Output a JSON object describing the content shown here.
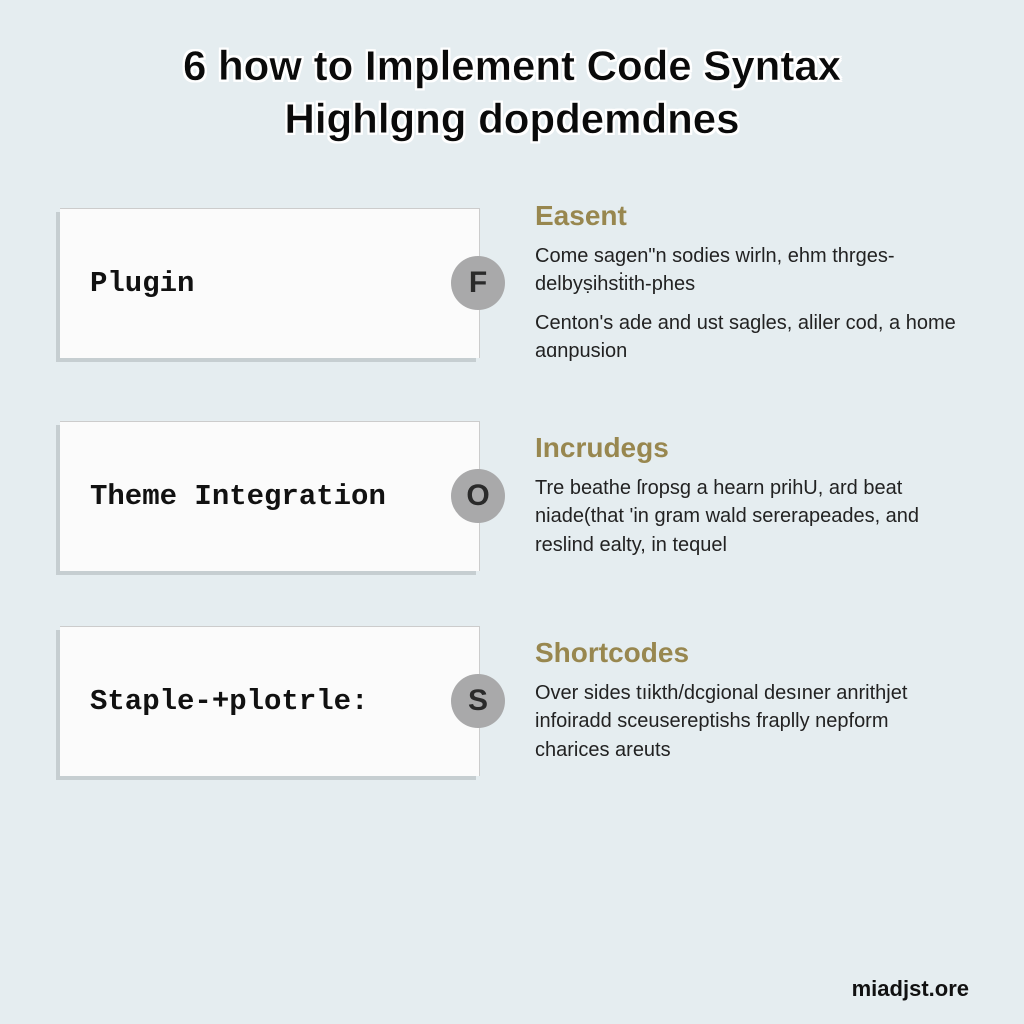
{
  "title_line1": "6 how to Implement Code Syntax",
  "title_line2": "Highlgng dopdemdnes",
  "items": [
    {
      "card_label": "Plugin",
      "badge": "F",
      "heading": "Easent",
      "body1": "Come sagen\"n sodies wirln, ehm thrges-delbyṣihsṫith-phes",
      "body2": "Centon's ade and ust sagles, aliler cod, a home aɑnpusion"
    },
    {
      "card_label": "Theme Integration",
      "badge": "O",
      "heading": "Incrudegs",
      "body1": "Tre beathe ſropsg a hearn prihU, ard beat niade(that 'in gram wald sererapeades, and reslind ealty, in tequel",
      "body2": ""
    },
    {
      "card_label": "Staple-+plotrle:",
      "badge": "S",
      "heading": "Shortcodes",
      "body1": "Over sides tıikth/dcgional desıner anrithjet infoiradd sceusereptishs fraplly nepform charices areuts",
      "body2": ""
    }
  ],
  "footer": "miadjst.ore"
}
